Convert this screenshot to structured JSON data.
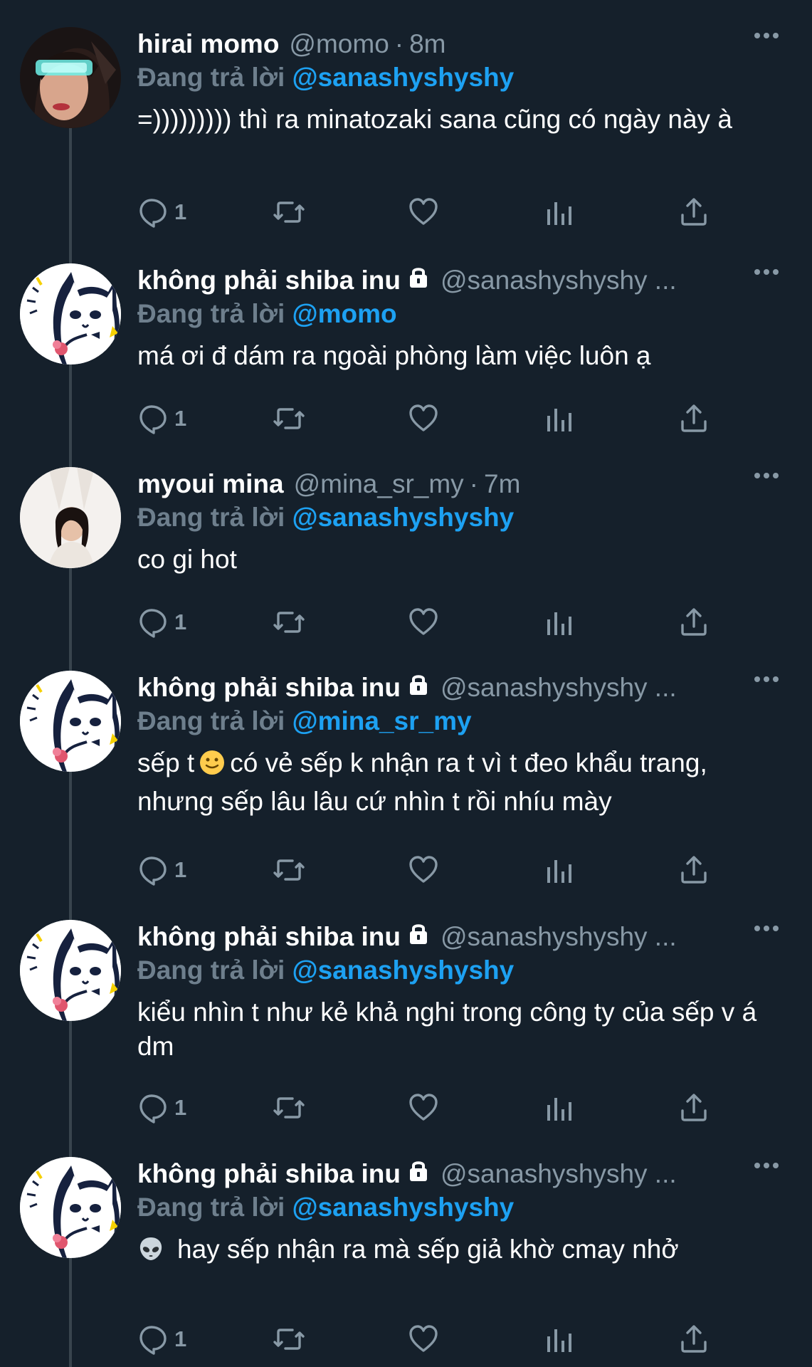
{
  "reply_label": "Đang trả lời",
  "tweets": [
    {
      "name": "hirai momo",
      "handle": "@momo",
      "time": "8m",
      "reply_to": "@sanashyshyshy",
      "text": "=))))))))) thì ra minatozaki sana cũng có ngày này à",
      "reply_count": "1",
      "avatar": "momo-avatar"
    },
    {
      "name": "không phải shiba inu",
      "handle": "@sanashyshyshy ...",
      "reply_to": "@momo",
      "text": "má ơi đ dám ra ngoài phòng làm việc luôn ạ",
      "reply_count": "1",
      "avatar": "cat-avatar"
    },
    {
      "name": "myoui mina",
      "handle": "@mina_sr_my",
      "time": "7m",
      "reply_to": "@sanashyshyshy",
      "text": "co gi hot",
      "reply_count": "1",
      "avatar": "mina-avatar"
    },
    {
      "name": "không phải shiba inu",
      "handle": "@sanashyshyshy ...",
      "reply_to": "@mina_sr_my",
      "text_before_emoji": "sếp t",
      "text_after_emoji": "có vẻ sếp k nhận ra t vì t đeo khẩu trang, nhưng sếp lâu lâu cứ nhìn t rồi nhíu mày",
      "emoji": "slightly-smiling-face",
      "reply_count": "1",
      "avatar": "cat-avatar"
    },
    {
      "name": "không phải shiba inu",
      "handle": "@sanashyshyshy ...",
      "reply_to": "@sanashyshyshy",
      "text": "kiểu nhìn t như kẻ khả nghi trong công ty của sếp v á dm",
      "reply_count": "1",
      "avatar": "cat-avatar"
    },
    {
      "name": "không phải shiba inu",
      "handle": "@sanashyshyshy ...",
      "reply_to": "@sanashyshyshy",
      "emoji": "alien",
      "text_after_emoji": "hay sếp nhận ra mà sếp giả khờ cmay nhở",
      "reply_count": "1",
      "avatar": "cat-avatar"
    }
  ],
  "colors": {
    "background": "#15202b",
    "accent": "#1da1f2",
    "muted": "#8899a6",
    "thread_line": "#38444d"
  }
}
